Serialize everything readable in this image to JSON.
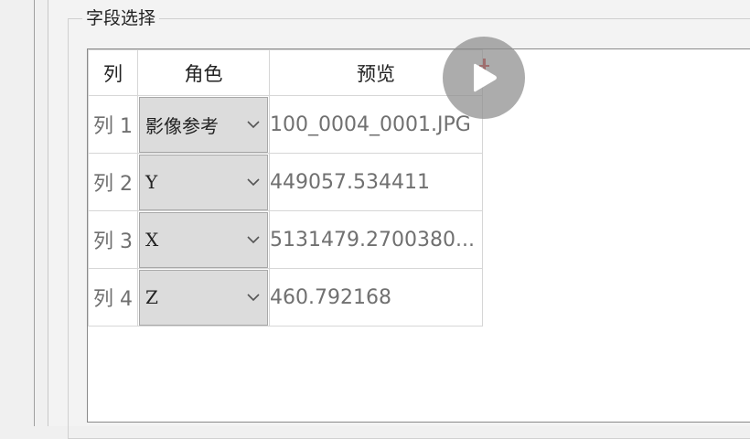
{
  "group": {
    "title": "字段选择"
  },
  "grid": {
    "headers": {
      "column": "列",
      "role": "角色",
      "preview": "预览"
    },
    "rows": [
      {
        "label": "列 1",
        "role": "影像参考",
        "preview": "100_0004_0001.JPG"
      },
      {
        "label": "列 2",
        "role": "Y",
        "preview": "449057.534411"
      },
      {
        "label": "列 3",
        "role": "X",
        "preview": "5131479.2700380..."
      },
      {
        "label": "列 4",
        "role": "Z",
        "preview": "460.792168"
      }
    ]
  },
  "icons": {
    "dropdown": "chevron-down-icon",
    "overlay": "play-icon"
  },
  "colors": {
    "combo_bg": "#dcdcdc",
    "overlay": "#8c8c8c",
    "accent_red": "#d02020"
  }
}
